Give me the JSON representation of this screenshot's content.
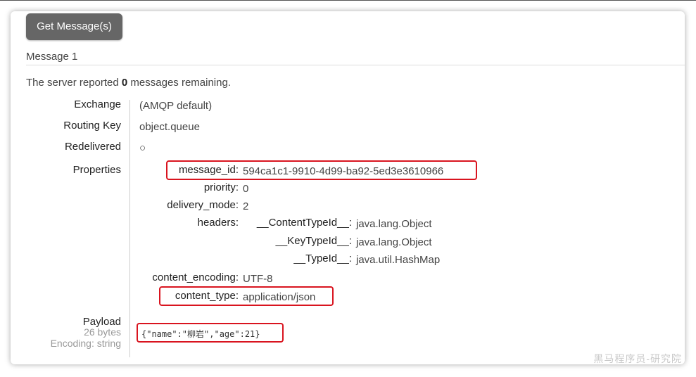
{
  "get_button_label": "Get Message(s)",
  "message_title": "Message 1",
  "remaining": {
    "prefix": "The server reported ",
    "count": "0",
    "suffix": " messages remaining."
  },
  "fields": {
    "exchange": {
      "label": "Exchange",
      "value": "(AMQP default)"
    },
    "routing_key": {
      "label": "Routing Key",
      "value": "object.queue"
    },
    "redelivered": {
      "label": "Redelivered",
      "value": "○"
    },
    "properties": {
      "label": "Properties"
    }
  },
  "properties": {
    "message_id": {
      "key": "message_id:",
      "value": "594ca1c1-9910-4d99-ba92-5ed3e3610966"
    },
    "priority": {
      "key": "priority:",
      "value": "0"
    },
    "delivery_mode": {
      "key": "delivery_mode:",
      "value": "2"
    },
    "headers_key": "headers:",
    "headers": [
      {
        "key": "__ContentTypeId__:",
        "value": "java.lang.Object"
      },
      {
        "key": "__KeyTypeId__:",
        "value": "java.lang.Object"
      },
      {
        "key": "__TypeId__:",
        "value": "java.util.HashMap"
      }
    ],
    "content_encoding": {
      "key": "content_encoding:",
      "value": "UTF-8"
    },
    "content_type": {
      "key": "content_type:",
      "value": "application/json"
    }
  },
  "payload": {
    "label": "Payload",
    "bytes": "26 bytes",
    "encoding": "Encoding: string",
    "value": "{\"name\":\"柳岩\",\"age\":21}"
  },
  "watermark": "黑马程序员-研究院",
  "highlight_color": "#d9141f"
}
